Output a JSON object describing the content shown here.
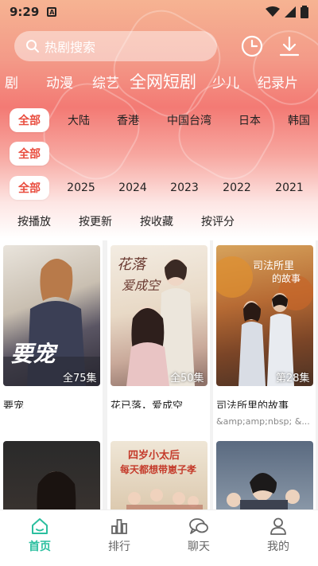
{
  "status": {
    "time": "9:29",
    "sim_label": "A"
  },
  "search": {
    "placeholder": "热剧搜索"
  },
  "categories": [
    "剧",
    "动漫",
    "综艺",
    "全网短剧",
    "少儿",
    "纪录片"
  ],
  "region_filters": [
    "全部",
    "大陆",
    "香港",
    "中国台湾",
    "日本",
    "韩国"
  ],
  "genre_filters": [
    "全部"
  ],
  "year_filters": [
    "全部",
    "2025",
    "2024",
    "2023",
    "2022",
    "2021"
  ],
  "sort_options": [
    "按播放",
    "按更新",
    "按收藏",
    "按评分"
  ],
  "cards": [
    {
      "title": "要宠",
      "episodes": "全75集",
      "subtitle": "",
      "calligraphy": "要宠"
    },
    {
      "title": "花已落，爱成空",
      "episodes": "全50集",
      "subtitle": ""
    },
    {
      "title": "司法所里的故事",
      "episodes": "第28集",
      "subtitle": "&amp;amp;nbsp; &..."
    }
  ],
  "nav": [
    {
      "label": "首页",
      "icon": "home-icon"
    },
    {
      "label": "排行",
      "icon": "ranking-icon"
    },
    {
      "label": "聊天",
      "icon": "chat-icon"
    },
    {
      "label": "我的",
      "icon": "profile-icon"
    }
  ],
  "colors": {
    "accent": "#e94d3f",
    "nav_active": "#2bbf9f"
  }
}
